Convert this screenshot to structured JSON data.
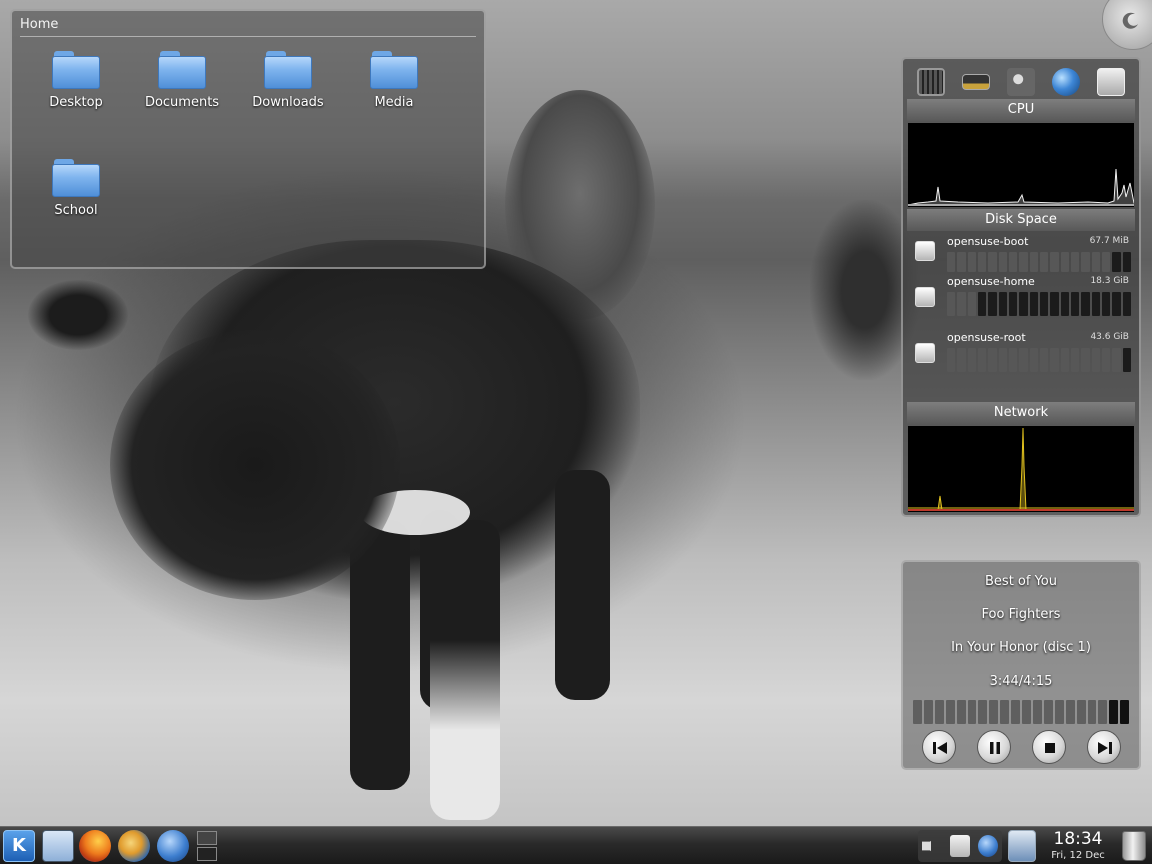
{
  "desktop": {
    "folderview": {
      "title": "Home",
      "items": [
        {
          "label": "Desktop"
        },
        {
          "label": "Documents"
        },
        {
          "label": "Downloads"
        },
        {
          "label": "Media"
        },
        {
          "label": "School"
        }
      ]
    }
  },
  "system_monitor": {
    "cpu": {
      "title": "CPU"
    },
    "disk": {
      "title": "Disk Space",
      "disks": [
        {
          "name": "opensuse-boot",
          "size": "67.7 MiB",
          "used_fraction": 0.12
        },
        {
          "name": "opensuse-home",
          "size": "18.3 GiB",
          "used_fraction": 0.82
        },
        {
          "name": "opensuse-root",
          "size": "43.6 GiB",
          "used_fraction": 0.06
        }
      ]
    },
    "network": {
      "title": "Network"
    },
    "icons": [
      "cpu-icon",
      "memory-icon",
      "hardware-icon",
      "network-globe-icon",
      "hard-disk-icon"
    ]
  },
  "now_playing": {
    "title": "Best of You",
    "artist": "Foo Fighters",
    "album": "In Your Honor (disc 1)",
    "time": "3:44/4:15",
    "progress_fraction": 0.88
  },
  "panel": {
    "clock": {
      "time": "18:34",
      "date": "Fri, 12 Dec"
    },
    "kmenu_label": "K",
    "launchers": [
      "dolphin-icon",
      "firefox-icon",
      "thunderbird-icon",
      "kopete-icon"
    ]
  }
}
